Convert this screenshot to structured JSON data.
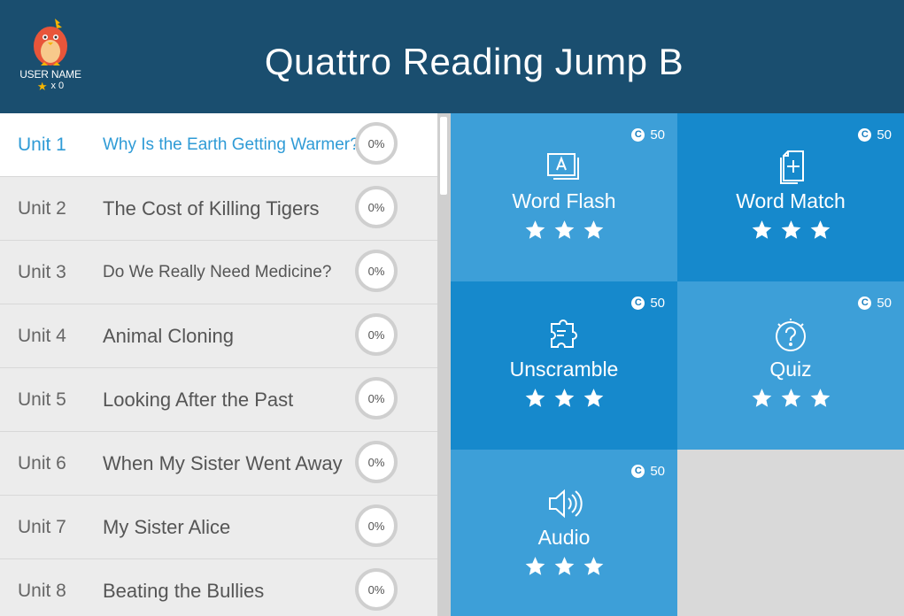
{
  "header": {
    "title": "Quattro Reading Jump B",
    "user_name": "USER NAME",
    "star_count": "x 0",
    "background": "#1a4e6f"
  },
  "units": [
    {
      "number": "Unit 1",
      "title": "Why Is the Earth Getting Warmer?",
      "progress": "0%",
      "active": true
    },
    {
      "number": "Unit 2",
      "title": "The Cost of Killing Tigers",
      "progress": "0%"
    },
    {
      "number": "Unit 3",
      "title": "Do We Really Need Medicine?",
      "progress": "0%"
    },
    {
      "number": "Unit 4",
      "title": "Animal Cloning",
      "progress": "0%"
    },
    {
      "number": "Unit 5",
      "title": "Looking After the Past",
      "progress": "0%"
    },
    {
      "number": "Unit 6",
      "title": "When My Sister Went Away",
      "progress": "0%"
    },
    {
      "number": "Unit 7",
      "title": "My Sister Alice",
      "progress": "0%"
    },
    {
      "number": "Unit 8",
      "title": "Beating the Bullies",
      "progress": "0%"
    }
  ],
  "activities": [
    {
      "label": "Word Flash",
      "coins": "50",
      "icon": "word-flash-icon",
      "stars": 3
    },
    {
      "label": "Word Match",
      "coins": "50",
      "icon": "word-match-icon",
      "stars": 3
    },
    {
      "label": "Unscramble",
      "coins": "50",
      "icon": "puzzle-icon",
      "stars": 3
    },
    {
      "label": "Quiz",
      "coins": "50",
      "icon": "question-icon",
      "stars": 3
    },
    {
      "label": "Audio",
      "coins": "50",
      "icon": "speaker-icon",
      "stars": 3
    }
  ],
  "colors": {
    "active_accent": "#2f9bd6",
    "tile_light": "#3d9fd8",
    "tile_dark": "#1689cc",
    "star_gold": "#f5b400"
  }
}
